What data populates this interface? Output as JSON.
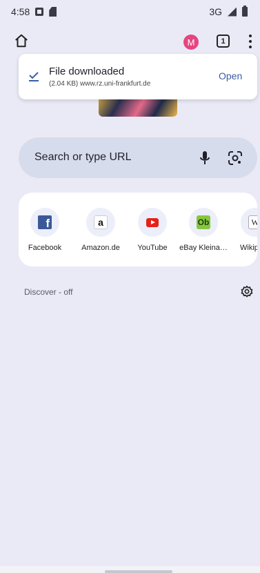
{
  "status": {
    "time": "4:58",
    "network": "3G"
  },
  "toolbar": {
    "avatar_letter": "M",
    "tab_count": "1"
  },
  "toast": {
    "title": "File downloaded",
    "subtitle": "(2.04 KB) www.rz.uni-frankfurt.de",
    "action": "Open"
  },
  "search": {
    "placeholder": "Search or type URL"
  },
  "shortcuts": [
    {
      "label": "Facebook",
      "icon": "facebook-icon",
      "glyph": "f"
    },
    {
      "label": "Amazon.de",
      "icon": "amazon-icon",
      "glyph": "a"
    },
    {
      "label": "YouTube",
      "icon": "youtube-icon",
      "glyph": ""
    },
    {
      "label": "eBay Kleina…",
      "icon": "ebay-kleinanzeigen-icon",
      "glyph": "Ob"
    },
    {
      "label": "Wikip",
      "icon": "wikipedia-icon",
      "glyph": "W"
    }
  ],
  "discover": {
    "label": "Discover - off"
  },
  "colors": {
    "background": "#eaeaf6",
    "search_bg": "#d7dcec",
    "avatar": "#e5467f",
    "link": "#3a5ca8"
  }
}
